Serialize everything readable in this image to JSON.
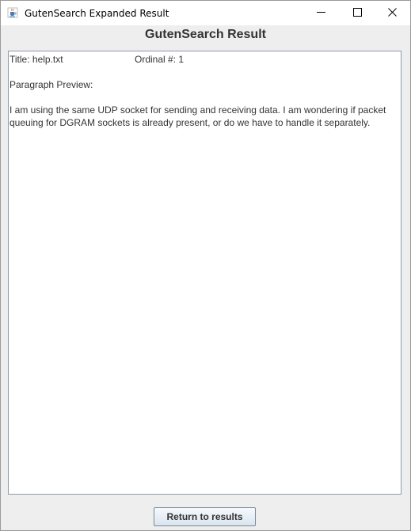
{
  "window": {
    "title": "GutenSearch Expanded Result",
    "controls": [
      "minimize",
      "maximize",
      "close"
    ]
  },
  "header": {
    "title": "GutenSearch Result"
  },
  "result": {
    "title_line": "Title: help.txt",
    "ordinal_line": "Ordinal #: 1",
    "preview_label": "Paragraph Preview:",
    "paragraph": "I am using the same UDP socket for sending and receiving data. I am wondering if packet queuing for DGRAM sockets is already present, or do we have to handle it separately."
  },
  "footer": {
    "return_button_label": "Return to results"
  },
  "icons": {
    "app": "java-cup-icon",
    "minimize": "minimize-icon",
    "maximize": "maximize-icon",
    "close": "close-icon"
  }
}
